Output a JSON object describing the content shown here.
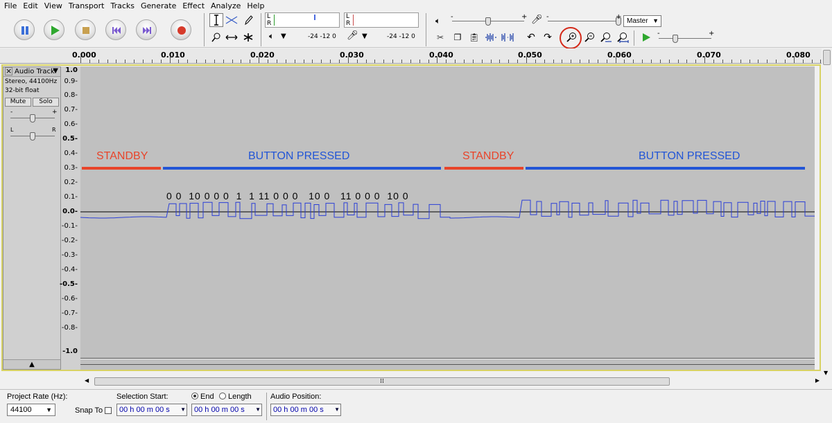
{
  "menu": [
    "File",
    "Edit",
    "View",
    "Transport",
    "Tracks",
    "Generate",
    "Effect",
    "Analyze",
    "Help"
  ],
  "meters": {
    "channel_l": "L",
    "channel_r": "R",
    "scale_1": "-24 -12 0",
    "scale_2": "-24 -12 0"
  },
  "mixer": {
    "device": "Master",
    "plus": "+",
    "minus": "-"
  },
  "ruler": {
    "labels": [
      "0.000",
      "0.010",
      "0.020",
      "0.030",
      "0.040",
      "0.050",
      "0.060",
      "0.070",
      "0.080"
    ]
  },
  "track": {
    "name": "Audio Track",
    "format_1": "Stereo, 44100Hz",
    "format_2": "32-bit float",
    "mute": "Mute",
    "solo": "Solo",
    "gain_minus": "-",
    "gain_plus": "+",
    "pan_left": "L",
    "pan_right": "R",
    "scale": [
      "1.0",
      "0.9-",
      "0.8-",
      "0.7-",
      "0.6-",
      "0.5-",
      "0.4-",
      "0.3-",
      "0.2-",
      "0.1-",
      "0.0-",
      "-0.1-",
      "-0.2-",
      "-0.3-",
      "-0.4-",
      "-0.5-",
      "-0.6-",
      "-0.7-",
      "-0.8-",
      "-1.0"
    ]
  },
  "annotations": {
    "standby_1": "STANDBY",
    "pressed_1": "BUTTON PRESSED",
    "standby_2": "STANDBY",
    "pressed_2": "BUTTON PRESSED",
    "bits": "0 0  10 0 0 0  1  1 11 0 0 0   10 0   11 0 0 0  10 0",
    "standby_color": "#e8442a",
    "pressed_color": "#2255d6"
  },
  "bottom": {
    "project_rate_label": "Project Rate (Hz):",
    "project_rate_value": "44100",
    "snap_to": "Snap To",
    "selection_start": "Selection Start:",
    "end": "End",
    "length": "Length",
    "audio_position": "Audio Position:",
    "time_zero": "00 h 00 m 00 s"
  }
}
